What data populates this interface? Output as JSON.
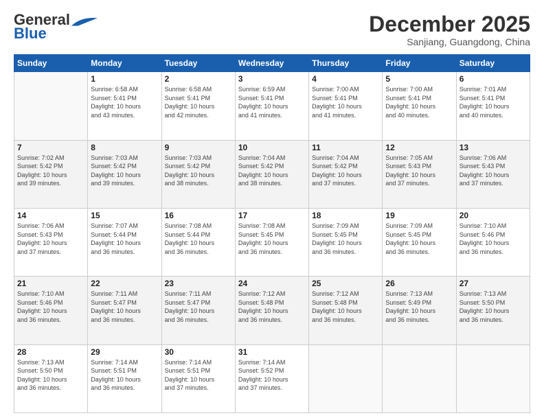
{
  "header": {
    "logo_line1": "General",
    "logo_line2": "Blue",
    "month": "December 2025",
    "location": "Sanjiang, Guangdong, China"
  },
  "weekdays": [
    "Sunday",
    "Monday",
    "Tuesday",
    "Wednesday",
    "Thursday",
    "Friday",
    "Saturday"
  ],
  "weeks": [
    [
      {
        "day": "",
        "info": ""
      },
      {
        "day": "1",
        "info": "Sunrise: 6:58 AM\nSunset: 5:41 PM\nDaylight: 10 hours\nand 43 minutes."
      },
      {
        "day": "2",
        "info": "Sunrise: 6:58 AM\nSunset: 5:41 PM\nDaylight: 10 hours\nand 42 minutes."
      },
      {
        "day": "3",
        "info": "Sunrise: 6:59 AM\nSunset: 5:41 PM\nDaylight: 10 hours\nand 41 minutes."
      },
      {
        "day": "4",
        "info": "Sunrise: 7:00 AM\nSunset: 5:41 PM\nDaylight: 10 hours\nand 41 minutes."
      },
      {
        "day": "5",
        "info": "Sunrise: 7:00 AM\nSunset: 5:41 PM\nDaylight: 10 hours\nand 40 minutes."
      },
      {
        "day": "6",
        "info": "Sunrise: 7:01 AM\nSunset: 5:41 PM\nDaylight: 10 hours\nand 40 minutes."
      }
    ],
    [
      {
        "day": "7",
        "info": "Sunrise: 7:02 AM\nSunset: 5:42 PM\nDaylight: 10 hours\nand 39 minutes."
      },
      {
        "day": "8",
        "info": "Sunrise: 7:03 AM\nSunset: 5:42 PM\nDaylight: 10 hours\nand 39 minutes."
      },
      {
        "day": "9",
        "info": "Sunrise: 7:03 AM\nSunset: 5:42 PM\nDaylight: 10 hours\nand 38 minutes."
      },
      {
        "day": "10",
        "info": "Sunrise: 7:04 AM\nSunset: 5:42 PM\nDaylight: 10 hours\nand 38 minutes."
      },
      {
        "day": "11",
        "info": "Sunrise: 7:04 AM\nSunset: 5:42 PM\nDaylight: 10 hours\nand 37 minutes."
      },
      {
        "day": "12",
        "info": "Sunrise: 7:05 AM\nSunset: 5:43 PM\nDaylight: 10 hours\nand 37 minutes."
      },
      {
        "day": "13",
        "info": "Sunrise: 7:06 AM\nSunset: 5:43 PM\nDaylight: 10 hours\nand 37 minutes."
      }
    ],
    [
      {
        "day": "14",
        "info": "Sunrise: 7:06 AM\nSunset: 5:43 PM\nDaylight: 10 hours\nand 37 minutes."
      },
      {
        "day": "15",
        "info": "Sunrise: 7:07 AM\nSunset: 5:44 PM\nDaylight: 10 hours\nand 36 minutes."
      },
      {
        "day": "16",
        "info": "Sunrise: 7:08 AM\nSunset: 5:44 PM\nDaylight: 10 hours\nand 36 minutes."
      },
      {
        "day": "17",
        "info": "Sunrise: 7:08 AM\nSunset: 5:45 PM\nDaylight: 10 hours\nand 36 minutes."
      },
      {
        "day": "18",
        "info": "Sunrise: 7:09 AM\nSunset: 5:45 PM\nDaylight: 10 hours\nand 36 minutes."
      },
      {
        "day": "19",
        "info": "Sunrise: 7:09 AM\nSunset: 5:45 PM\nDaylight: 10 hours\nand 36 minutes."
      },
      {
        "day": "20",
        "info": "Sunrise: 7:10 AM\nSunset: 5:46 PM\nDaylight: 10 hours\nand 36 minutes."
      }
    ],
    [
      {
        "day": "21",
        "info": "Sunrise: 7:10 AM\nSunset: 5:46 PM\nDaylight: 10 hours\nand 36 minutes."
      },
      {
        "day": "22",
        "info": "Sunrise: 7:11 AM\nSunset: 5:47 PM\nDaylight: 10 hours\nand 36 minutes."
      },
      {
        "day": "23",
        "info": "Sunrise: 7:11 AM\nSunset: 5:47 PM\nDaylight: 10 hours\nand 36 minutes."
      },
      {
        "day": "24",
        "info": "Sunrise: 7:12 AM\nSunset: 5:48 PM\nDaylight: 10 hours\nand 36 minutes."
      },
      {
        "day": "25",
        "info": "Sunrise: 7:12 AM\nSunset: 5:48 PM\nDaylight: 10 hours\nand 36 minutes."
      },
      {
        "day": "26",
        "info": "Sunrise: 7:13 AM\nSunset: 5:49 PM\nDaylight: 10 hours\nand 36 minutes."
      },
      {
        "day": "27",
        "info": "Sunrise: 7:13 AM\nSunset: 5:50 PM\nDaylight: 10 hours\nand 36 minutes."
      }
    ],
    [
      {
        "day": "28",
        "info": "Sunrise: 7:13 AM\nSunset: 5:50 PM\nDaylight: 10 hours\nand 36 minutes."
      },
      {
        "day": "29",
        "info": "Sunrise: 7:14 AM\nSunset: 5:51 PM\nDaylight: 10 hours\nand 36 minutes."
      },
      {
        "day": "30",
        "info": "Sunrise: 7:14 AM\nSunset: 5:51 PM\nDaylight: 10 hours\nand 37 minutes."
      },
      {
        "day": "31",
        "info": "Sunrise: 7:14 AM\nSunset: 5:52 PM\nDaylight: 10 hours\nand 37 minutes."
      },
      {
        "day": "",
        "info": ""
      },
      {
        "day": "",
        "info": ""
      },
      {
        "day": "",
        "info": ""
      }
    ]
  ]
}
